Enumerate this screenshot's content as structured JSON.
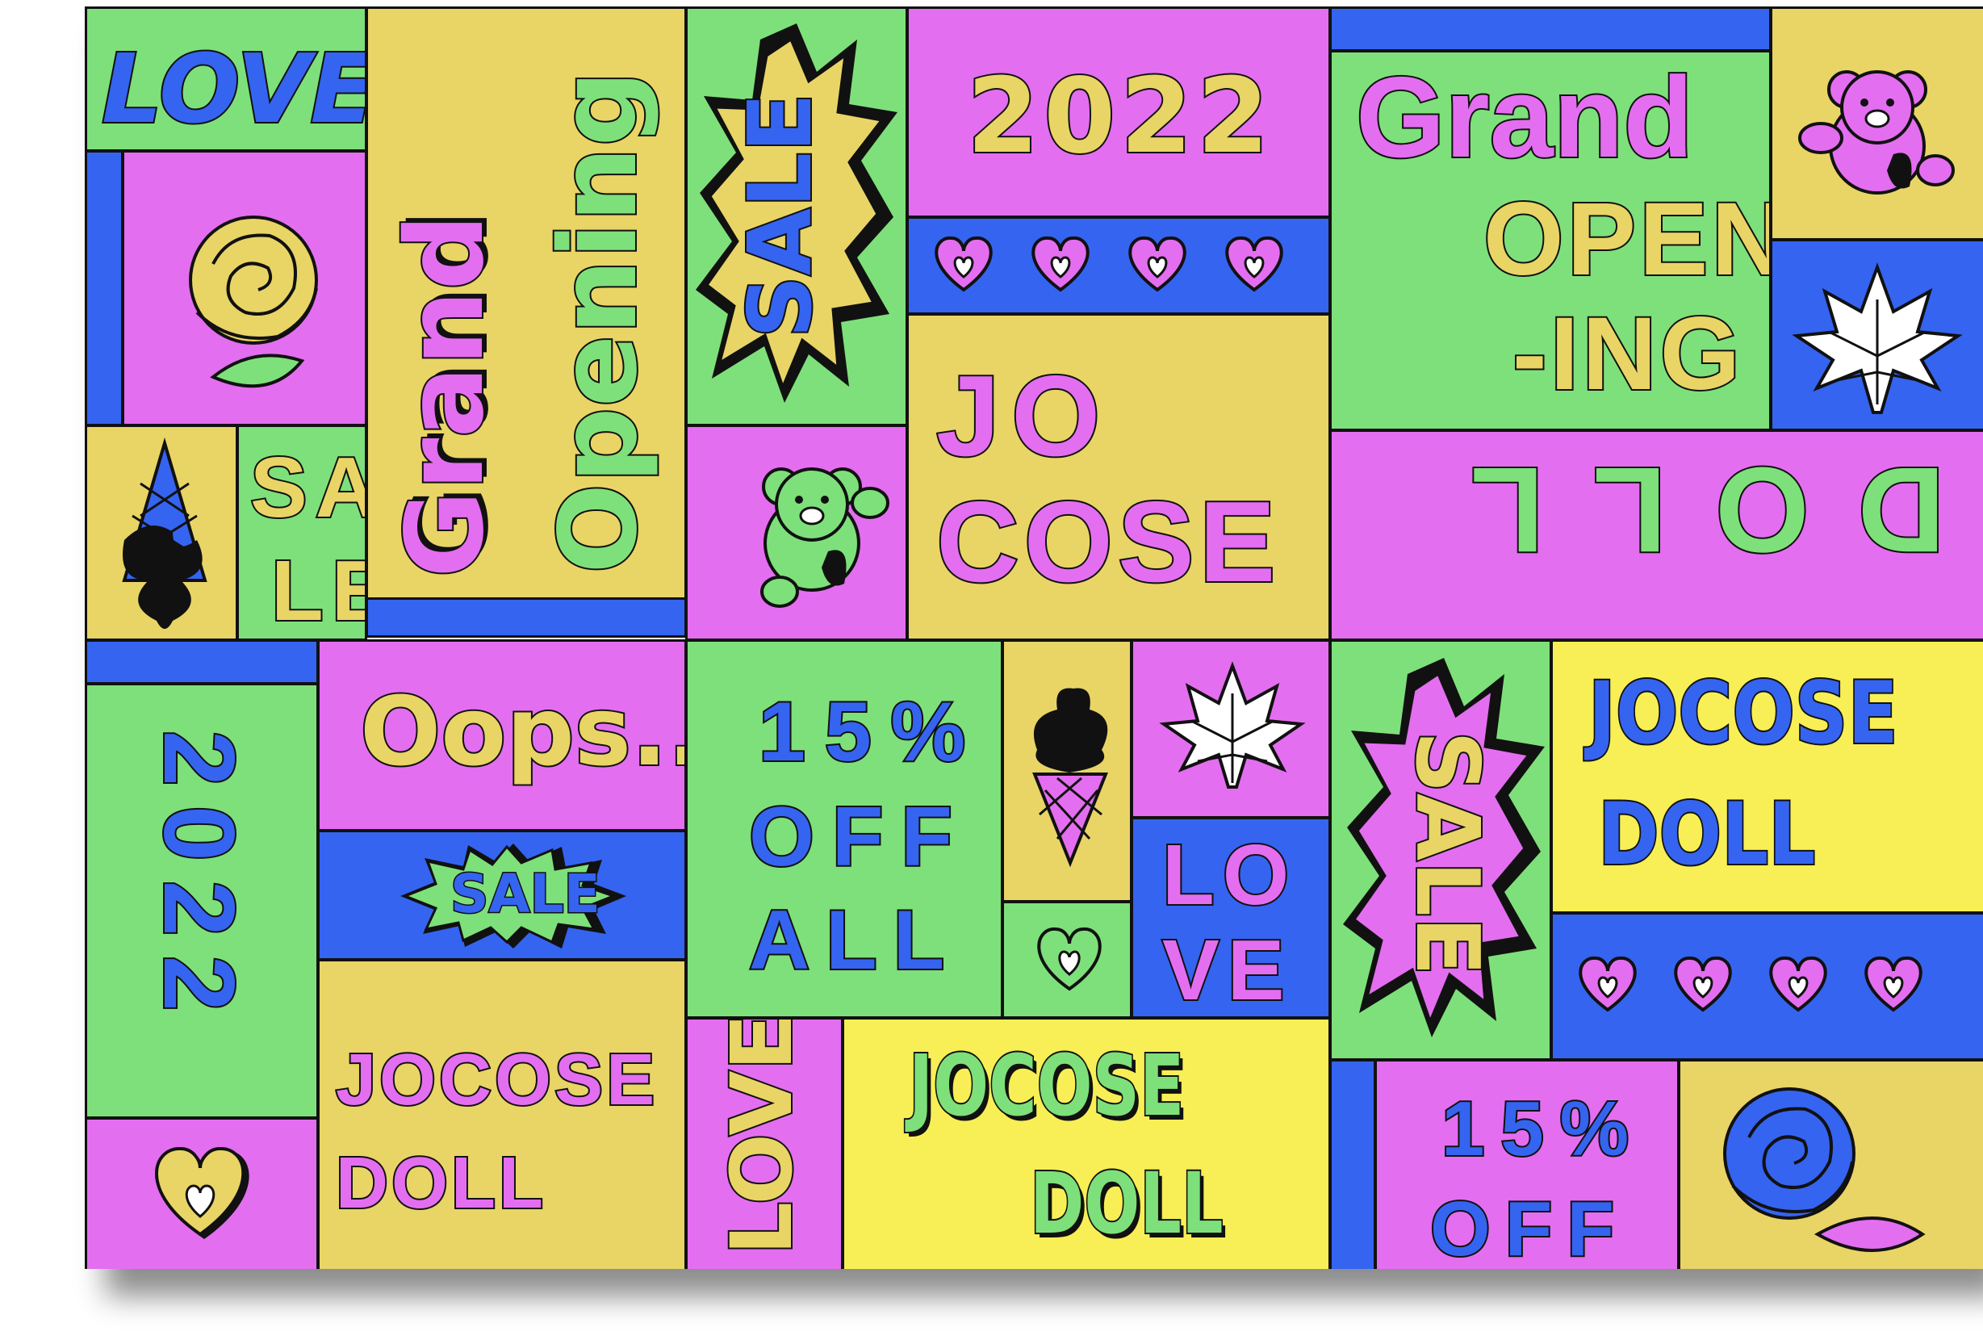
{
  "poster": {
    "love_top": "LOVE",
    "grand_v": "Grand",
    "opening_v": "Opening",
    "sale_burst_top": "SALE",
    "year_top": "2022",
    "grand_right": "Grand",
    "open_right": "OPEN",
    "ing_right": "-ING",
    "sa": "SA",
    "le": "LE",
    "jo": "JO",
    "cose": "COSE",
    "doll_rotated": "DOLL",
    "year_left": "2022",
    "oops": "Oops..",
    "sale_small": "SALE",
    "pct_15": "15%",
    "off": "OFF",
    "all": "ALL",
    "lo": "LO",
    "ve": "VE",
    "sale_burst_right": "SALE",
    "jocose_right": "JOCOSE",
    "doll_right": "DOLL",
    "jocose_bottom_left": "JOCOSE",
    "doll_bottom_left": "DOLL",
    "love_bottom": "LOVE",
    "jocose_bottom_mid": "JOCOSE",
    "doll_bottom_mid": "DOLL",
    "pct_15_bottom": "15%",
    "off_bottom": "OFF"
  },
  "palette": {
    "green": "#7ee07a",
    "pink": "#e46ef0",
    "yellow": "#e9d466",
    "blue": "#3564f0",
    "light_yellow": "#f7ef55",
    "outline": "#111111"
  },
  "icons": [
    "rose-icon",
    "teddy-bear-icon",
    "heart-icon",
    "ice-cream-icon",
    "maple-leaf-icon",
    "starburst-icon"
  ]
}
